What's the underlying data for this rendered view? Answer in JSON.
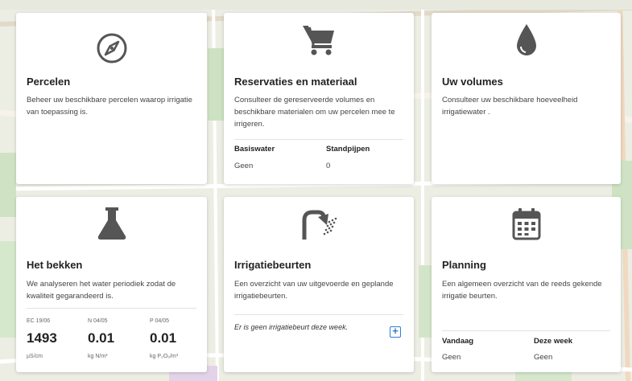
{
  "cards": {
    "percelen": {
      "title": "Percelen",
      "description": "Beheer uw beschikbare percelen waarop irrigatie van toepassing is.",
      "icon": "compass-icon"
    },
    "reservaties": {
      "title": "Reservaties en materiaal",
      "description": "Consulteer de gereserveerde volumes en beschikbare materialen om uw percelen mee te irrigeren.",
      "icon": "cart-icon",
      "columns": [
        {
          "label": "Basiswater",
          "value": "Geen"
        },
        {
          "label": "Standpijpen",
          "value": "0"
        }
      ]
    },
    "volumes": {
      "title": "Uw volumes",
      "description": "Consulteer uw beschikbare hoeveelheid irrigatiewater .",
      "icon": "water-drop-icon"
    },
    "bekken": {
      "title": "Het bekken",
      "description": "We analyseren het water periodiek zodat de kwaliteit gegarandeerd is.",
      "icon": "flask-icon",
      "metrics": [
        {
          "label": "EC 19/06",
          "value": "1493",
          "unit": "µS/cm"
        },
        {
          "label": "N 04/05",
          "value": "0.01",
          "unit": "kg N/m³"
        },
        {
          "label": "P 04/05",
          "value": "0.01",
          "unit": "kg P₂O₅/m³"
        }
      ]
    },
    "irrigatiebeurten": {
      "title": "Irrigatiebeurten",
      "description": "Een overzicht van uw uitgevoerde en geplande irrigatiebeurten.",
      "icon": "shower-icon",
      "note": "Er is geen irrigatiebeurt deze week.",
      "add_icon": "plus-square-icon"
    },
    "planning": {
      "title": "Planning",
      "description": "Een algemeen overzicht van de reeds gekende irrigatie beurten.",
      "icon": "calendar-icon",
      "columns": [
        {
          "label": "Vandaag",
          "value": "Geen"
        },
        {
          "label": "Deze week",
          "value": "Geen"
        }
      ]
    }
  },
  "colors": {
    "icon_gray": "#555555",
    "accent_blue": "#2f7fd6",
    "map_bg": "#eef0e6"
  }
}
